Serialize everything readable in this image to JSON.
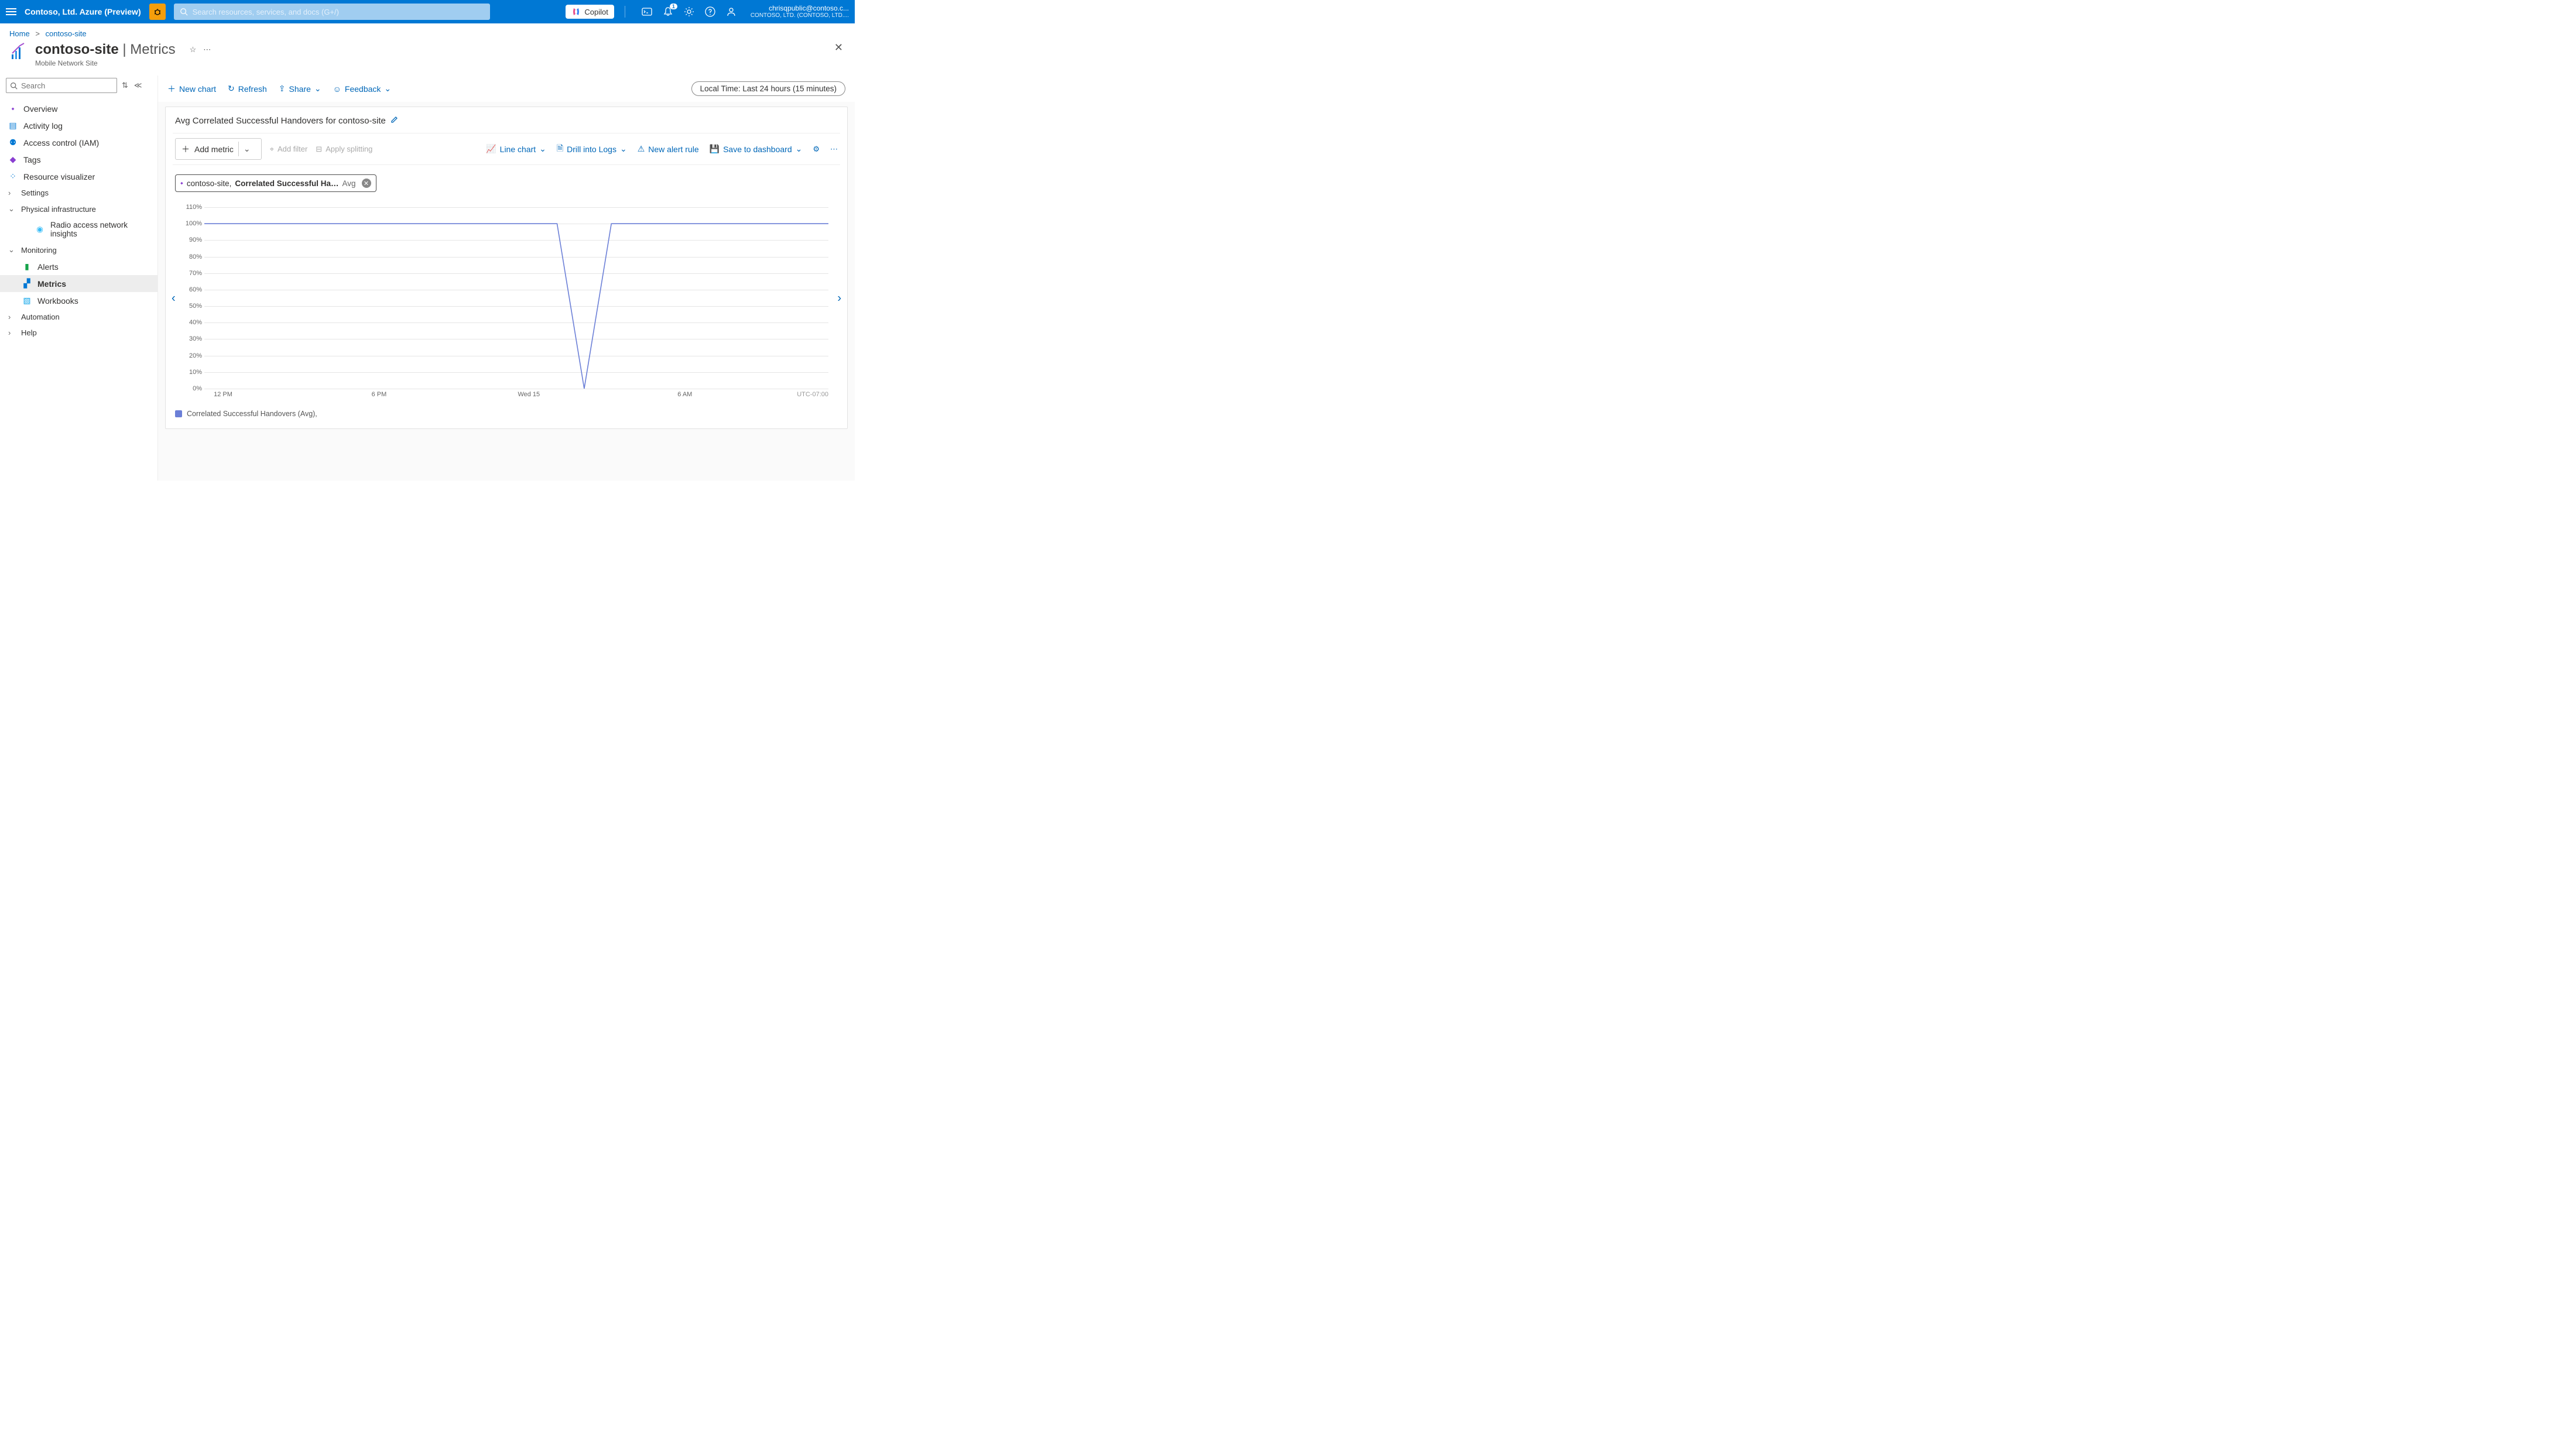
{
  "topbar": {
    "brand": "Contoso, Ltd. Azure (Preview)",
    "search_placeholder": "Search resources, services, and docs (G+/)",
    "copilot": "Copilot",
    "notif_badge": "1",
    "user_line1": "chrisqpublic@contoso.c...",
    "user_line2": "CONTOSO, LTD. (CONTOSO, LTD...."
  },
  "breadcrumb": {
    "home": "Home",
    "site": "contoso-site"
  },
  "page": {
    "title_main": "contoso-site",
    "title_sep": " | ",
    "title_section": "Metrics",
    "subtype": "Mobile Network Site"
  },
  "sidebar": {
    "search_placeholder": "Search",
    "items": [
      {
        "label": "Overview"
      },
      {
        "label": "Activity log"
      },
      {
        "label": "Access control (IAM)"
      },
      {
        "label": "Tags"
      },
      {
        "label": "Resource visualizer"
      },
      {
        "label": "Settings"
      },
      {
        "label": "Physical infrastructure"
      },
      {
        "label": "Radio access network insights"
      },
      {
        "label": "Monitoring"
      },
      {
        "label": "Alerts"
      },
      {
        "label": "Metrics"
      },
      {
        "label": "Workbooks"
      },
      {
        "label": "Automation"
      },
      {
        "label": "Help"
      }
    ]
  },
  "toolbar": {
    "new_chart": "New chart",
    "refresh": "Refresh",
    "share": "Share",
    "feedback": "Feedback",
    "time": "Local Time: Last 24 hours (15 minutes)"
  },
  "card": {
    "title": "Avg Correlated Successful Handovers for contoso-site",
    "add_metric": "Add metric",
    "add_filter": "Add filter",
    "apply_splitting": "Apply splitting",
    "line_chart": "Line chart",
    "drill_logs": "Drill into Logs",
    "new_alert": "New alert rule",
    "save_dash": "Save to dashboard"
  },
  "chip": {
    "scope": "contoso-site,",
    "metric": "Correlated Successful Ha…",
    "agg": "Avg"
  },
  "legend": {
    "label": "Correlated Successful Handovers (Avg),"
  },
  "chart_data": {
    "type": "line",
    "title": "Avg Correlated Successful Handovers for contoso-site",
    "ylabel": "%",
    "ylim": [
      0,
      110
    ],
    "y_ticks": [
      "110%",
      "100%",
      "90%",
      "80%",
      "70%",
      "60%",
      "50%",
      "40%",
      "30%",
      "20%",
      "10%",
      "0%"
    ],
    "x_ticks": [
      "12 PM",
      "6 PM",
      "Wed 15",
      "6 AM",
      "UTC-07:00"
    ],
    "series": [
      {
        "name": "Correlated Successful Handovers (Avg)",
        "color": "#6b7fd7",
        "x": [
          0,
          1,
          2,
          3,
          4,
          5,
          6,
          7,
          8,
          9,
          10,
          11,
          12,
          13,
          14,
          15,
          16,
          17,
          18,
          19,
          20,
          21,
          22,
          23
        ],
        "values": [
          100,
          100,
          100,
          100,
          100,
          100,
          100,
          100,
          100,
          100,
          100,
          100,
          100,
          100,
          0,
          100,
          100,
          100,
          100,
          100,
          100,
          100,
          100,
          100
        ]
      }
    ]
  }
}
